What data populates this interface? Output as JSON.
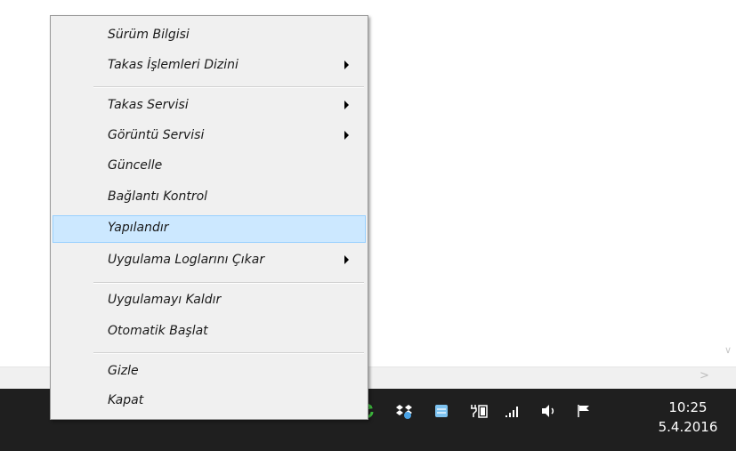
{
  "menu": {
    "items": [
      {
        "label": "Sürüm Bilgisi",
        "submenu": false
      },
      {
        "label": "Takas İşlemleri Dizini",
        "submenu": true
      },
      {
        "label": "Takas Servisi",
        "submenu": true
      },
      {
        "label": "Görüntü Servisi",
        "submenu": true
      },
      {
        "label": "Güncelle",
        "submenu": false
      },
      {
        "label": "Bağlantı Kontrol",
        "submenu": false
      },
      {
        "label": "Yapılandır",
        "submenu": false,
        "highlighted": true
      },
      {
        "label": "Uygulama Loglarını Çıkar",
        "submenu": true
      },
      {
        "label": "Uygulamayı Kaldır",
        "submenu": false
      },
      {
        "label": "Otomatik Başlat",
        "submenu": false
      },
      {
        "label": "Gizle",
        "submenu": false
      },
      {
        "label": "Kapat",
        "submenu": false
      }
    ]
  },
  "taskbar": {
    "clock_time": "10:25",
    "clock_date": "5.4.2016",
    "tray_icons": [
      "show-hidden-icons-chevron-icon",
      "sync-app-icon",
      "dropbox-icon",
      "app-tray-icon",
      "power-plug-icon",
      "signal-bars-icon",
      "volume-icon",
      "action-center-flag-icon"
    ]
  },
  "colors": {
    "menu_bg": "#f0f0f0",
    "highlight_bg": "#cce8ff",
    "highlight_border": "#99d1ff",
    "taskbar_bg": "#1f1f1f",
    "sync_icon_green": "#3fbf3f",
    "dropbox_blue": "#7ec3f0"
  }
}
